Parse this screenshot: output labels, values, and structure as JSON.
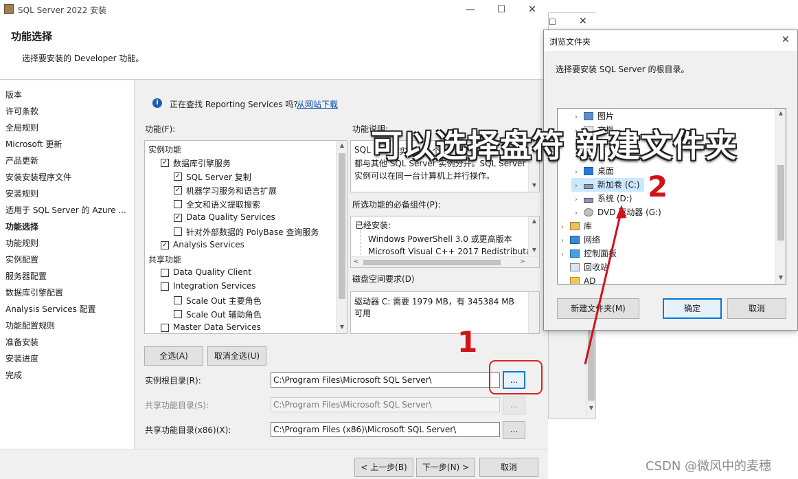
{
  "main_window": {
    "title": "SQL Server 2022 安装",
    "header_title": "功能选择",
    "header_subtitle": "选择要安装的 Developer 功能。"
  },
  "nav": {
    "items": [
      "版本",
      "许可条款",
      "全局规则",
      "Microsoft 更新",
      "产品更新",
      "安装安装程序文件",
      "安装规则",
      "适用于 SQL Server 的 Azure ...",
      "功能选择",
      "功能规则",
      "实例配置",
      "服务器配置",
      "数据库引擎配置",
      "Analysis Services 配置",
      "功能配置规则",
      "准备安装",
      "安装进度",
      "完成"
    ],
    "active": "功能选择"
  },
  "info": {
    "text": "正在查找 Reporting Services 吗?",
    "link": "从网站下载"
  },
  "features": {
    "label": "功能(F):",
    "tree": [
      {
        "text": "实例功能",
        "type": "group"
      },
      {
        "text": "数据库引擎服务",
        "checked": true
      },
      {
        "text": "SQL Server 复制",
        "checked": true
      },
      {
        "text": "机器学习服务和语言扩展",
        "checked": true
      },
      {
        "text": "全文和语义提取搜索",
        "checked": false
      },
      {
        "text": "Data Quality Services",
        "checked": true
      },
      {
        "text": "针对外部数据的 PolyBase 查询服务",
        "checked": false
      },
      {
        "text": "Analysis Services",
        "checked": true
      },
      {
        "text": "共享功能",
        "type": "group"
      },
      {
        "text": "Data Quality Client",
        "checked": false
      },
      {
        "text": "Integration Services",
        "checked": false
      },
      {
        "text": "Scale Out 主要角色",
        "checked": false
      },
      {
        "text": "Scale Out 辅助角色",
        "checked": false
      },
      {
        "text": "Master Data Services",
        "checked": false
      }
    ]
  },
  "description": {
    "label": "功能说明:",
    "text_line1": "SQL",
    "text_line1b": "实",
    "text_line1c": "个",
    "text_line2": "都与其他 SQL Server 实例分开。SQL Server",
    "text_line3": "实例可以在同一台计算机上并行操作。"
  },
  "prereq": {
    "label": "所选功能的必备组件(P):",
    "installed_label": "已经安装:",
    "items": [
      "Windows PowerShell 3.0 或更高版本",
      "Microsoft Visual C++ 2017 Redistributa"
    ]
  },
  "disk": {
    "label": "磁盘空间要求(D)",
    "text": "驱动器 C: 需要 1979 MB，有 345384 MB 可用"
  },
  "buttons": {
    "select_all": "全选(A)",
    "unselect_all": "取消全选(U)",
    "browse": "...",
    "back": "< 上一步(B)",
    "next": "下一步(N) >",
    "cancel": "取消"
  },
  "paths": {
    "instance_root_label": "实例根目录(R):",
    "instance_root_value": "C:\\Program Files\\Microsoft SQL Server\\",
    "shared_label": "共享功能目录(S):",
    "shared_value": "C:\\Program Files\\Microsoft SQL Server\\",
    "shared_x86_label": "共享功能目录(x86)(X):",
    "shared_x86_value": "C:\\Program Files (x86)\\Microsoft SQL Server\\"
  },
  "dialog": {
    "title": "浏览文件夹",
    "prompt": "选择要安装 SQL Server 的根目录。",
    "tree": [
      {
        "text": "图片",
        "icon": "pictures",
        "level": 1,
        "expander": true
      },
      {
        "text": "文档",
        "icon": "documents",
        "level": 1,
        "expander": true
      },
      {
        "text": "",
        "icon": "downloads",
        "level": 1,
        "expander": true
      },
      {
        "text": "桌面",
        "icon": "desktop",
        "level": 1,
        "expander": true
      },
      {
        "text": "新加卷 (C:)",
        "icon": "drive",
        "level": 1,
        "expander": true,
        "selected": true
      },
      {
        "text": "系统 (D:)",
        "icon": "drive",
        "level": 1,
        "expander": true
      },
      {
        "text": "DVD 驱动器 (G:)",
        "icon": "dvd",
        "level": 1,
        "expander": true
      },
      {
        "text": "库",
        "icon": "library",
        "level": 0,
        "expander": true
      },
      {
        "text": "网络",
        "icon": "network",
        "level": 0,
        "expander": true
      },
      {
        "text": "控制面板",
        "icon": "control-panel",
        "level": 0,
        "expander": true
      },
      {
        "text": "回收站",
        "icon": "recycle",
        "level": 0,
        "expander": false
      },
      {
        "text": "AD",
        "icon": "folder",
        "level": 0,
        "expander": false
      }
    ],
    "new_folder": "新建文件夹(M)",
    "ok": "确定",
    "cancel": "取消"
  },
  "annotations": {
    "overlay": "可以选择盘符 新建文件夹",
    "num1": "1",
    "num2": "2",
    "watermark": "CSDN @微风中的麦穗",
    "red": "#d0121b"
  }
}
